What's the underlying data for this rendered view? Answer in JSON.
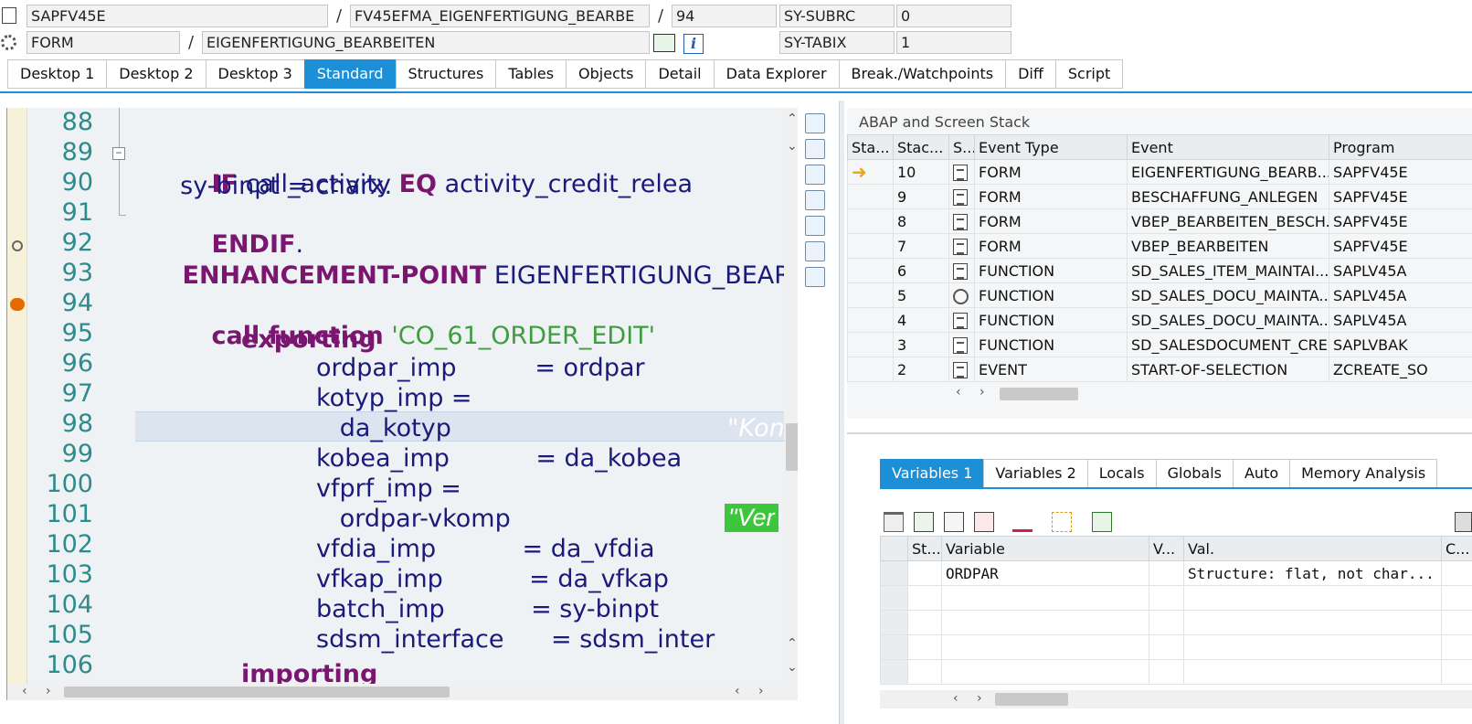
{
  "header": {
    "row1": {
      "program": "SAPFV45E",
      "include": "FV45EFMA_EIGENFERTIGUNG_BEARBE",
      "line": "94",
      "var_label": "SY-SUBRC",
      "var_value": "0"
    },
    "row2": {
      "type": "FORM",
      "name": "EIGENFERTIGUNG_BEARBEITEN",
      "var_label": "SY-TABIX",
      "var_value": "1"
    },
    "slash": "/"
  },
  "tabs": [
    "Desktop 1",
    "Desktop 2",
    "Desktop 3",
    "Standard",
    "Structures",
    "Tables",
    "Objects",
    "Detail",
    "Data Explorer",
    "Break./Watchpoints",
    "Diff",
    "Script"
  ],
  "active_tab": "Standard",
  "editor": {
    "line_numbers": [
      "88",
      "89",
      "90",
      "91",
      "92",
      "93",
      "94",
      "95",
      "96",
      "97",
      "98",
      "99",
      "100",
      "101",
      "102",
      "103",
      "104",
      "105",
      "106"
    ],
    "lines": {
      "l89": {
        "kw1": "IF",
        "t1": " call_activity ",
        "kw2": "EQ",
        "t2": " activity_credit_relea"
      },
      "l90": "  sy-binpt = charx.",
      "l91": {
        "kw": "ENDIF",
        "t": "."
      },
      "l92": {
        "kw": "ENHANCEMENT-POINT",
        "t": " EIGENFERTIGUNG_BEARBEITEN"
      },
      "l94": {
        "kw": "call function",
        "str": " 'CO_61_ORDER_EDIT'"
      },
      "l95": "exporting",
      "l96": "ordpar_imp          = ordpar",
      "l97": "kotyp_imp =",
      "l98": "   da_kotyp",
      "l98_comment": "\"Kon",
      "l99": "kobea_imp           = da_kobea",
      "l100": "vfprf_imp =",
      "l101": "   ordpar-vkomp",
      "l101_comment": "\"Ver",
      "l102": "vfdia_imp           = da_vfdia",
      "l103": "vfkap_imp           = da_vfkap",
      "l104": "batch_imp           = sy-binpt",
      "l105": "sdsm_interface      = sdsm_inter",
      "l106": "importing"
    }
  },
  "stack": {
    "title": "ABAP and Screen Stack",
    "columns": [
      "Sta...",
      "Stac...",
      "S...",
      "Event Type",
      "Event",
      "Program"
    ],
    "rows": [
      {
        "current": true,
        "level": "10",
        "icon": "document-icon",
        "type": "FORM",
        "event": "EIGENFERTIGUNG_BEARB...",
        "program": "SAPFV45E"
      },
      {
        "current": false,
        "level": "9",
        "icon": "document-icon",
        "type": "FORM",
        "event": "BESCHAFFUNG_ANLEGEN",
        "program": "SAPFV45E"
      },
      {
        "current": false,
        "level": "8",
        "icon": "document-icon",
        "type": "FORM",
        "event": "VBEP_BEARBEITEN_BESCH...",
        "program": "SAPFV45E"
      },
      {
        "current": false,
        "level": "7",
        "icon": "document-icon",
        "type": "FORM",
        "event": "VBEP_BEARBEITEN",
        "program": "SAPFV45E"
      },
      {
        "current": false,
        "level": "6",
        "icon": "document-icon",
        "type": "FUNCTION",
        "event": "SD_SALES_ITEM_MAINTAI...",
        "program": "SAPLV45A"
      },
      {
        "current": false,
        "level": "5",
        "icon": "circle-icon",
        "type": "FUNCTION",
        "event": "SD_SALES_DOCU_MAINTA...",
        "program": "SAPLV45A"
      },
      {
        "current": false,
        "level": "4",
        "icon": "document-icon",
        "type": "FUNCTION",
        "event": "SD_SALES_DOCU_MAINTA...",
        "program": "SAPLV45A"
      },
      {
        "current": false,
        "level": "3",
        "icon": "document-icon",
        "type": "FUNCTION",
        "event": "SD_SALESDOCUMENT_CRE...",
        "program": "SAPLVBAK"
      },
      {
        "current": false,
        "level": "2",
        "icon": "document-icon",
        "type": "EVENT",
        "event": "START-OF-SELECTION",
        "program": "ZCREATE_SO"
      }
    ]
  },
  "var_tabs": [
    "Variables 1",
    "Variables 2",
    "Locals",
    "Globals",
    "Auto",
    "Memory Analysis"
  ],
  "active_var_tab": "Variables 1",
  "variables": {
    "columns": [
      "St...",
      "Variable",
      "V...",
      "Val.",
      "C..."
    ],
    "rows": [
      {
        "variable": "ORDPAR",
        "value": "Structure: flat, not char..."
      }
    ]
  },
  "colors": {
    "accent": "#1d8fd6",
    "keyword": "#7a1670",
    "string": "#3f9d3f",
    "linenumber": "#2f8b8b"
  }
}
